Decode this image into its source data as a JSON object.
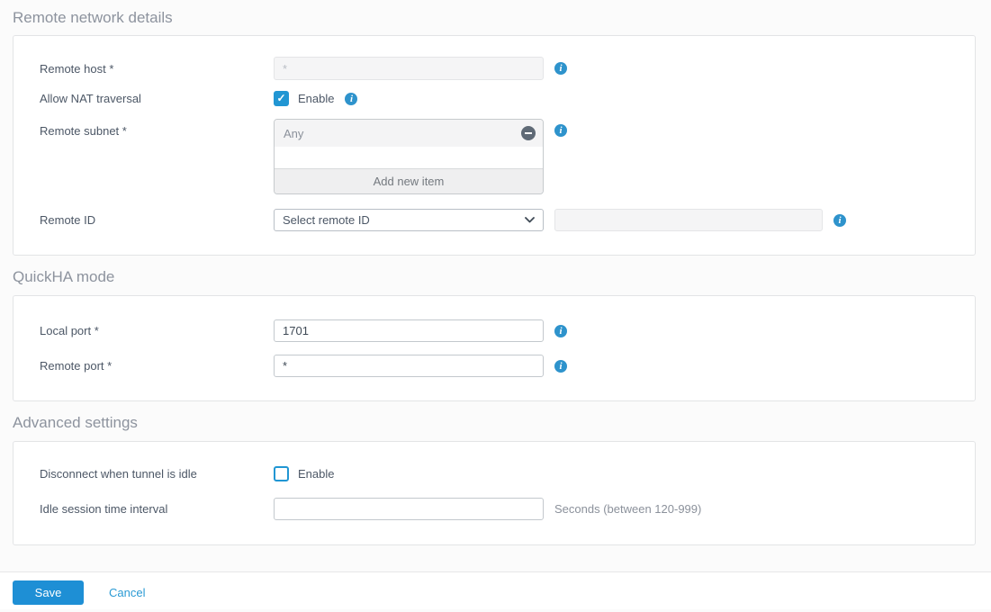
{
  "colors": {
    "accent_blue": "#1e8fd5",
    "info_icon_blue": "#2e93cc",
    "checkbox_blue": "#2196d3",
    "section_title_gray": "#8d939e",
    "label_slate": "#4c5766",
    "hint_gray": "#8b919b",
    "remove_icon_gray": "#5f6a76"
  },
  "icons": {
    "info": "i",
    "check": "✓",
    "remove": "minus-circle",
    "chevron": "chevron-down"
  },
  "sections": [
    {
      "title": "Remote network details",
      "rows": [
        {
          "label": "Remote host *",
          "value": "",
          "placeholder": "*",
          "disabled": true
        },
        {
          "label": "Allow NAT traversal",
          "checkbox_label": "Enable",
          "checked": true
        },
        {
          "label": "Remote subnet *",
          "items": [
            {
              "text": "Any"
            }
          ],
          "add_label": "Add new item"
        },
        {
          "label": "Remote ID",
          "select_value": "Select remote ID",
          "value": "",
          "disabled_secondary": true
        }
      ]
    },
    {
      "title": "QuickHA mode",
      "rows": [
        {
          "label": "Local port *",
          "value": "1701"
        },
        {
          "label": "Remote port *",
          "value": "*"
        }
      ]
    },
    {
      "title": "Advanced settings",
      "rows": [
        {
          "label": "Disconnect when tunnel is idle",
          "checkbox_label": "Enable",
          "checked": false
        },
        {
          "label": "Idle session time interval",
          "value": "",
          "hint": "Seconds (between 120-999)"
        }
      ]
    }
  ],
  "footer": {
    "save": "Save",
    "cancel": "Cancel"
  }
}
